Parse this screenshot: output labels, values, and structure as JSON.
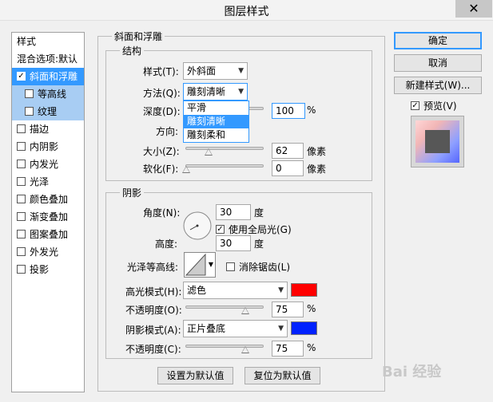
{
  "window": {
    "title": "图层样式",
    "close_glyph": "✕"
  },
  "left_panel": {
    "header": "样式",
    "items": [
      {
        "label": "混合选项:默认",
        "checkbox": false,
        "checked": false
      },
      {
        "label": "斜面和浮雕",
        "checkbox": true,
        "checked": true
      },
      {
        "label": "等高线",
        "checkbox": true,
        "checked": false
      },
      {
        "label": "纹理",
        "checkbox": true,
        "checked": false
      },
      {
        "label": "描边",
        "checkbox": true,
        "checked": false
      },
      {
        "label": "内阴影",
        "checkbox": true,
        "checked": false
      },
      {
        "label": "内发光",
        "checkbox": true,
        "checked": false
      },
      {
        "label": "光泽",
        "checkbox": true,
        "checked": false
      },
      {
        "label": "颜色叠加",
        "checkbox": true,
        "checked": false
      },
      {
        "label": "渐变叠加",
        "checkbox": true,
        "checked": false
      },
      {
        "label": "图案叠加",
        "checkbox": true,
        "checked": false
      },
      {
        "label": "外发光",
        "checkbox": true,
        "checked": false
      },
      {
        "label": "投影",
        "checkbox": true,
        "checked": false
      }
    ]
  },
  "bevel": {
    "section_title": "斜面和浮雕",
    "structure_title": "结构",
    "style_label": "样式(T):",
    "style_value": "外斜面",
    "method_label": "方法(Q):",
    "method_value": "雕刻清晰",
    "method_options": [
      "平滑",
      "雕刻清晰",
      "雕刻柔和"
    ],
    "depth_label": "深度(D):",
    "depth_value": "100",
    "depth_unit": "%",
    "direction_label": "方向:",
    "size_label": "大小(Z):",
    "size_value": "62",
    "size_unit": "像素",
    "soften_label": "软化(F):",
    "soften_value": "0",
    "soften_unit": "像素"
  },
  "shading": {
    "section_title": "阴影",
    "angle_label": "角度(N):",
    "angle_value": "30",
    "angle_unit": "度",
    "global_light_label": "使用全局光(G)",
    "global_light_checked": true,
    "altitude_label": "高度:",
    "altitude_value": "30",
    "altitude_unit": "度",
    "gloss_contour_label": "光泽等高线:",
    "anti_alias_label": "消除锯齿(L)",
    "anti_alias_checked": false,
    "highlight_mode_label": "高光模式(H):",
    "highlight_mode_value": "滤色",
    "highlight_color": "#ff0000",
    "highlight_opacity_label": "不透明度(O):",
    "highlight_opacity_value": "75",
    "shadow_mode_label": "阴影模式(A):",
    "shadow_mode_value": "正片叠底",
    "shadow_color": "#0022ff",
    "shadow_opacity_label": "不透明度(C):",
    "shadow_opacity_value": "75",
    "percent": "%"
  },
  "buttons": {
    "make_default": "设置为默认值",
    "reset_default": "复位为默认值",
    "ok": "确定",
    "cancel": "取消",
    "new_style": "新建样式(W)...",
    "preview_label": "预览(V)",
    "preview_checked": true
  },
  "watermark": "Bai 经验"
}
